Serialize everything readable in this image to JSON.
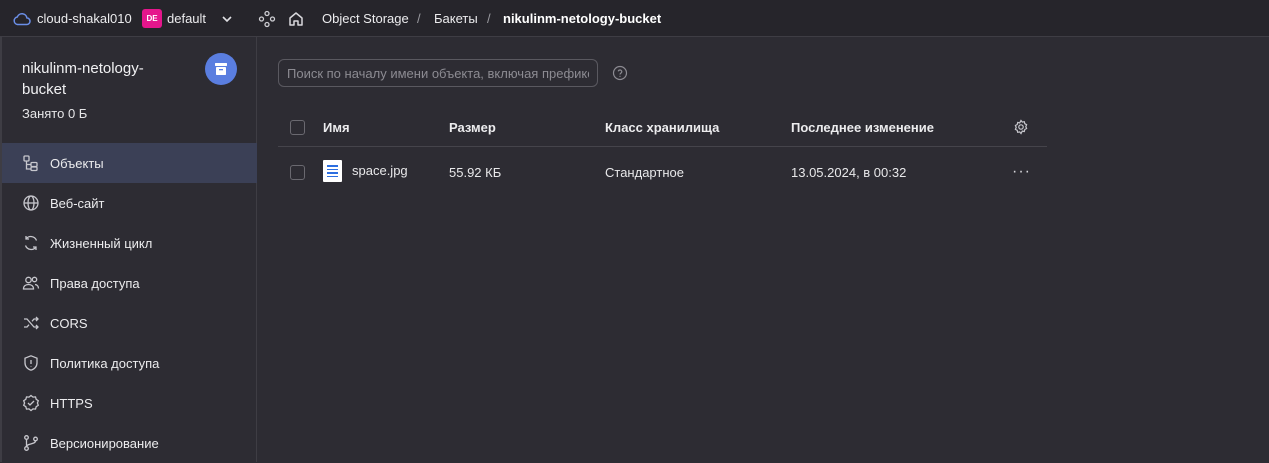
{
  "topbar": {
    "cloud_name": "cloud-shakal010",
    "folder_badge": "DE",
    "folder_name": "default",
    "breadcrumbs": [
      "Object Storage",
      "Бакеты",
      "nikulinm-netology-bucket"
    ],
    "separator": "/"
  },
  "bucket": {
    "name": "nikulinm-netology-bucket",
    "usage": "Занято 0 Б"
  },
  "sidebar": {
    "items": [
      {
        "label": "Объекты",
        "icon": "objects-icon",
        "active": true
      },
      {
        "label": "Веб-сайт",
        "icon": "globe-icon"
      },
      {
        "label": "Жизненный цикл",
        "icon": "lifecycle-icon"
      },
      {
        "label": "Права доступа",
        "icon": "users-icon"
      },
      {
        "label": "CORS",
        "icon": "shuffle-icon"
      },
      {
        "label": "Политика доступа",
        "icon": "shield-icon"
      },
      {
        "label": "HTTPS",
        "icon": "check-badge-icon"
      },
      {
        "label": "Версионирование",
        "icon": "branch-icon"
      }
    ]
  },
  "search": {
    "placeholder": "Поиск по началу имени объекта, включая префикс",
    "value": ""
  },
  "table": {
    "columns": [
      "Имя",
      "Размер",
      "Класс хранилища",
      "Последнее изменение"
    ],
    "rows": [
      {
        "name": "space.jpg",
        "size": "55.92 КБ",
        "storage_class": "Стандартное",
        "modified": "13.05.2024, в 00:32"
      }
    ],
    "row_menu_glyph": "···"
  },
  "colors": {
    "background": "#2d2c33",
    "topbar": "#26252b",
    "active_nav": "#3b4056",
    "folder_badge": "#e5168c",
    "bucket_avatar": "#5a7ee0"
  }
}
